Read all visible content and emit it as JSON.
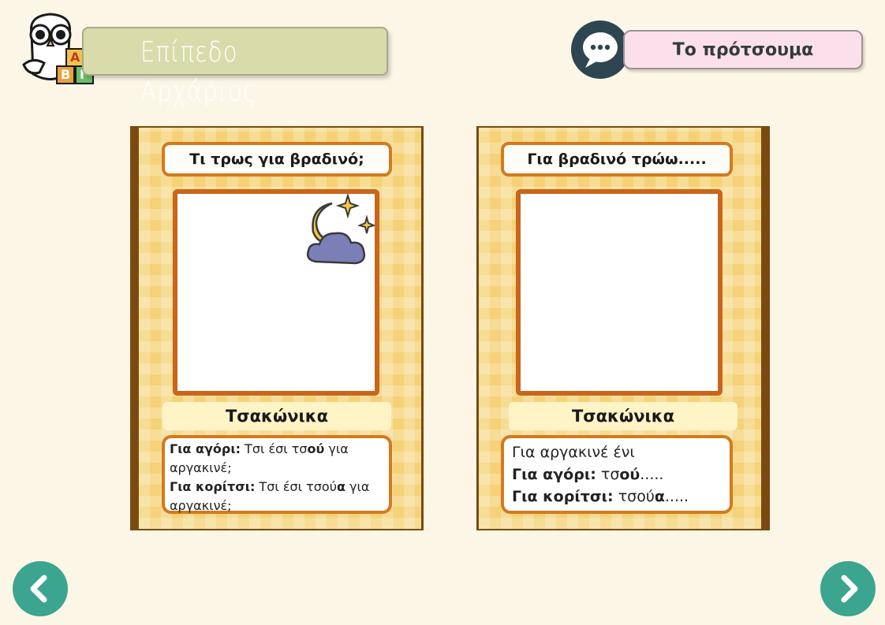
{
  "header": {
    "level_title": "Επίπεδο Αρχάριος",
    "logo_blocks": [
      "Α",
      "Β",
      "Γ"
    ]
  },
  "suggestion": {
    "label": "Το πρότσουμα",
    "icon": "speech-bubble-icon"
  },
  "cards": [
    {
      "title": "Τι τρως για βραδινό;",
      "image_icon": "moon-cloud-stars-icon",
      "language_label": "Τσακώνικα",
      "lines": {
        "boy_label": "Για αγόρι:",
        "boy_text_1": " Τσι έσι τσ",
        "boy_bold": "ού",
        "boy_text_2": " για αργακινέ;",
        "girl_label": "Για κορίτσι:",
        "girl_text_1": " Τσι έσι τσού",
        "girl_bold": "α",
        "girl_text_2": " για αργακινέ;"
      }
    },
    {
      "title": "Για βραδινό τρώω.....",
      "language_label": "Τσακώνικα",
      "lines": {
        "intro": "Για αργακινέ ένι",
        "boy_label": "Για αγόρι:",
        "boy_text_1": " τσ",
        "boy_bold": "ού",
        "boy_text_2": ".....",
        "girl_label": "Για κορίτσι:",
        "girl_text_1": " τσού",
        "girl_bold": "α",
        "girl_text_2": "....."
      }
    }
  ],
  "navigation": {
    "prev_icon": "chevron-left-icon",
    "next_icon": "chevron-right-icon"
  },
  "colors": {
    "background": "#fcf6e6",
    "banner": "#d8dcab",
    "pill": "#fbe0ec",
    "card": "#f5d277",
    "card_border": "#d57a1d",
    "nav": "#3ba58f"
  }
}
